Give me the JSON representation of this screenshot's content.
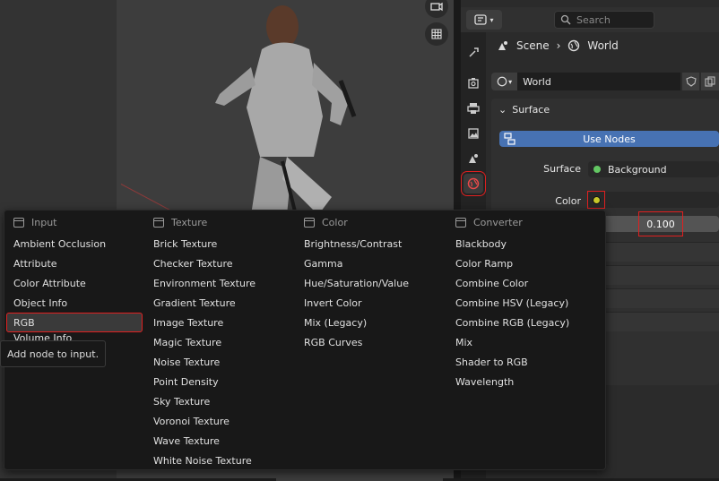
{
  "header": {
    "search_placeholder": "Search"
  },
  "breadcrumb": {
    "scene": "Scene",
    "world": "World"
  },
  "world_field": {
    "name": "World"
  },
  "surface_panel": {
    "title": "Surface",
    "use_nodes_label": "Use Nodes",
    "surface_label": "Surface",
    "surface_value": "Background",
    "color_label": "Color",
    "strength_value": "0.100"
  },
  "menu": {
    "columns": [
      {
        "header": "Input",
        "items": [
          "Ambient Occlusion",
          "Attribute",
          "Color Attribute",
          "Object Info",
          "RGB",
          "Volume Info"
        ]
      },
      {
        "header": "Texture",
        "items": [
          "Brick Texture",
          "Checker Texture",
          "Environment Texture",
          "Gradient Texture",
          "Image Texture",
          "Magic Texture",
          "Noise Texture",
          "Point Density",
          "Sky Texture",
          "Voronoi Texture",
          "Wave Texture",
          "White Noise Texture"
        ]
      },
      {
        "header": "Color",
        "items": [
          "Brightness/Contrast",
          "Gamma",
          "Hue/Saturation/Value",
          "Invert Color",
          "Mix (Legacy)",
          "RGB Curves"
        ]
      },
      {
        "header": "Converter",
        "items": [
          "Blackbody",
          "Color Ramp",
          "Combine Color",
          "Combine HSV (Legacy)",
          "Combine RGB (Legacy)",
          "Mix",
          "Shader to RGB",
          "Wavelength"
        ]
      }
    ]
  },
  "tooltip": {
    "text": "Add node to input."
  },
  "colors": {
    "accent_blue": "#4772b3",
    "highlight_red": "#e02020",
    "socket_green": "#63c763",
    "socket_yellow": "#c7c729"
  }
}
